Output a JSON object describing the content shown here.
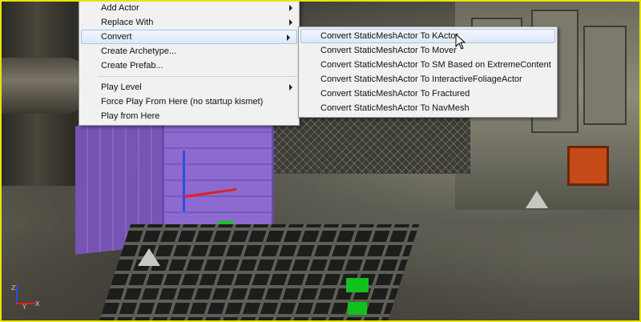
{
  "context_menu": {
    "items": [
      {
        "label": "Add Actor",
        "has_submenu": true
      },
      {
        "label": "Replace With",
        "has_submenu": true
      },
      {
        "label": "Convert",
        "has_submenu": true,
        "highlighted": true
      },
      {
        "label": "Create Archetype...",
        "has_submenu": false
      },
      {
        "label": "Create Prefab...",
        "has_submenu": false
      },
      {
        "label": "Play Level",
        "has_submenu": true
      },
      {
        "label": "Force Play From Here (no startup kismet)",
        "has_submenu": false
      },
      {
        "label": "Play from Here",
        "has_submenu": false
      }
    ]
  },
  "convert_submenu": {
    "items": [
      {
        "label": "Convert StaticMeshActor To KActor",
        "highlighted": true
      },
      {
        "label": "Convert StaticMeshActor To Mover"
      },
      {
        "label": "Convert StaticMeshActor To SM Based on ExtremeContent"
      },
      {
        "label": "Convert StaticMeshActor To InteractiveFoliageActor"
      },
      {
        "label": "Convert StaticMeshActor To Fractured"
      },
      {
        "label": "Convert StaticMeshActor To NavMesh"
      }
    ]
  },
  "viewport": {
    "border_color": "#e8e400",
    "selected_actor_color": "#8a66c8",
    "gizmo_colors": {
      "x": "#e02020",
      "y": "#18c428",
      "z": "#2a4fe0"
    },
    "axis_indicator": {
      "labels": [
        "Z",
        "X",
        "Y"
      ]
    }
  },
  "icons": [
    "submenu-arrow-icon",
    "mouse-cursor-icon",
    "transform-gizmo-icon",
    "axis-indicator-icon"
  ]
}
